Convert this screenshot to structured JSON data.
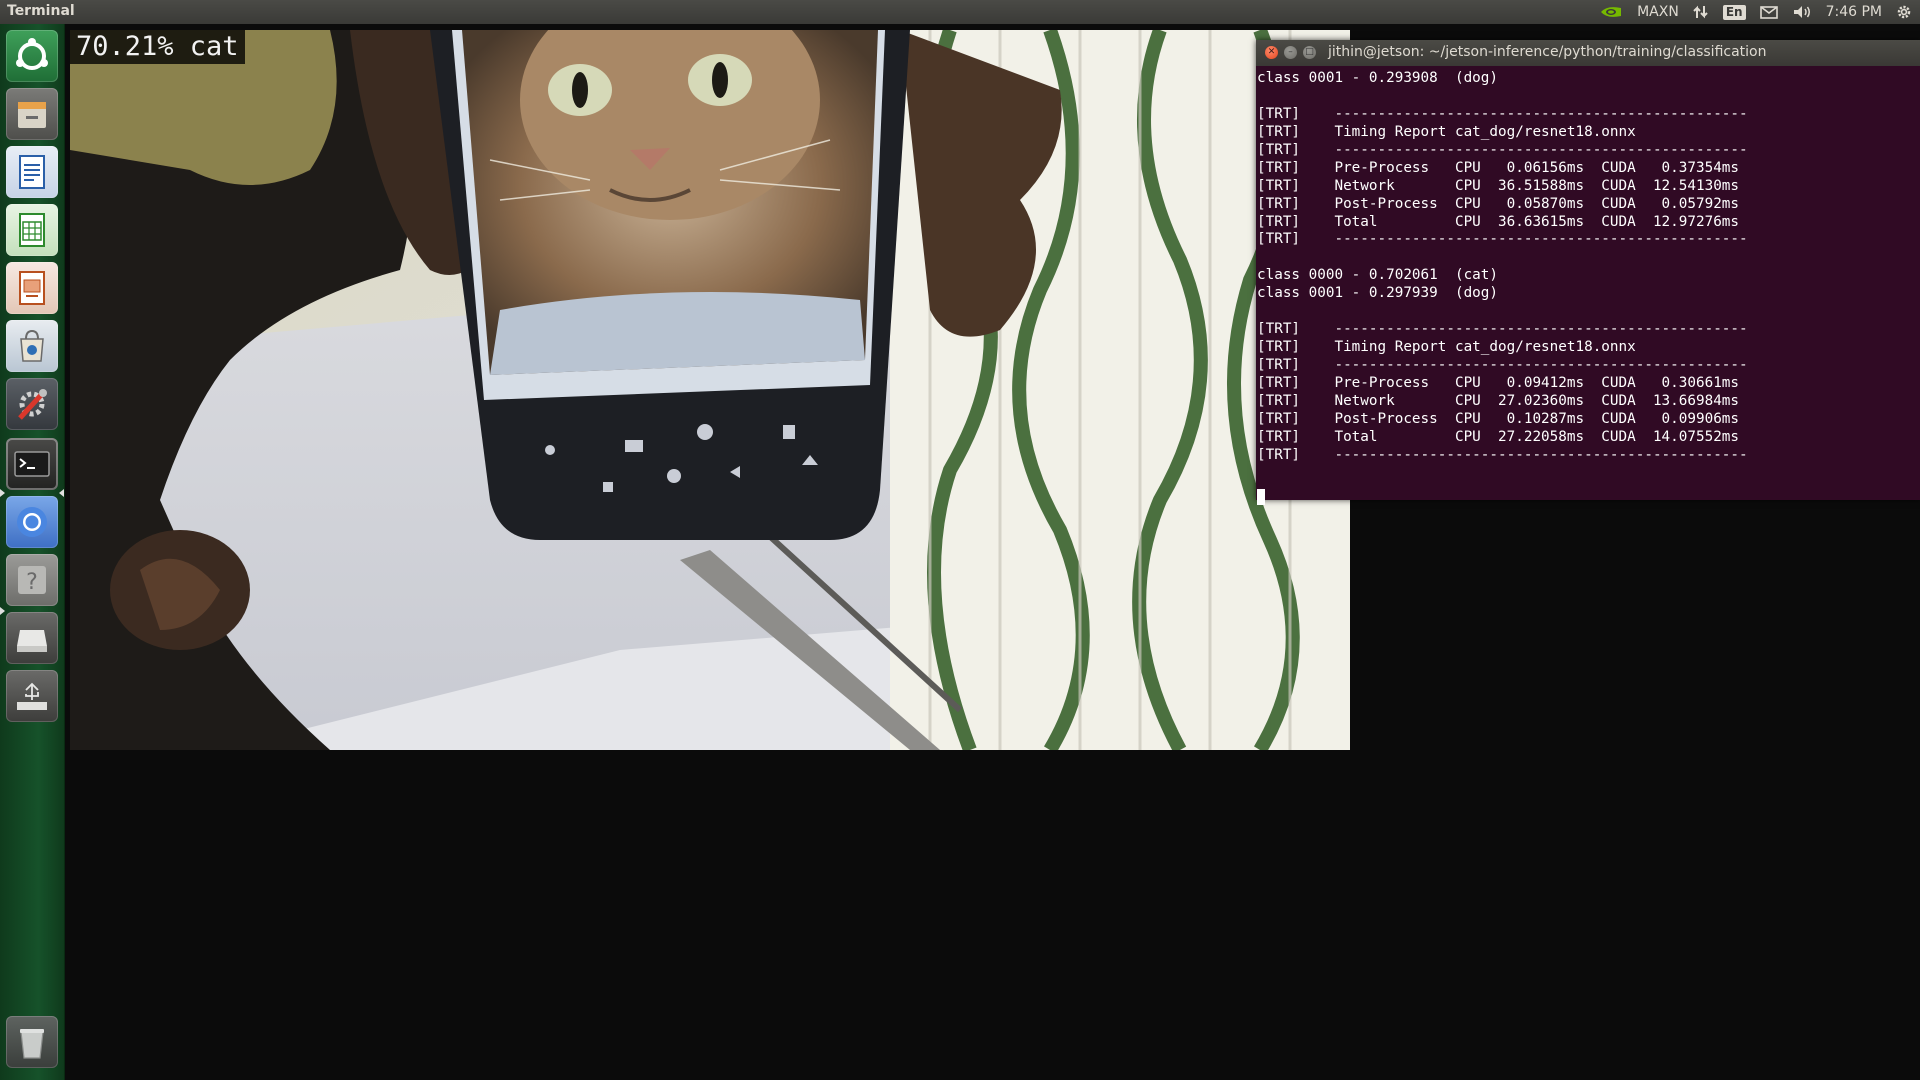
{
  "top_panel": {
    "app_title": "Terminal",
    "power_mode": "MAXN",
    "keyboard_layout": "En",
    "clock": "7:46 PM"
  },
  "launcher": {
    "items": [
      {
        "name": "ubuntu-software-updater-icon"
      },
      {
        "name": "files-icon"
      },
      {
        "name": "writer-icon"
      },
      {
        "name": "calc-icon"
      },
      {
        "name": "impress-icon"
      },
      {
        "name": "software-center-icon"
      },
      {
        "name": "system-settings-icon"
      },
      {
        "name": "terminal-icon"
      },
      {
        "name": "chromium-icon"
      },
      {
        "name": "help-icon"
      },
      {
        "name": "drive-icon"
      },
      {
        "name": "usb-drive-icon"
      },
      {
        "name": "trash-icon"
      }
    ]
  },
  "camera": {
    "overlay_text": "70.21% cat"
  },
  "terminal": {
    "title": "jithin@jetson: ~/jetson-inference/python/training/classification",
    "lines": [
      "class 0001 - 0.293908  (dog)",
      "",
      "[TRT]    ------------------------------------------------",
      "[TRT]    Timing Report cat_dog/resnet18.onnx",
      "[TRT]    ------------------------------------------------",
      "[TRT]    Pre-Process   CPU   0.06156ms  CUDA   0.37354ms",
      "[TRT]    Network       CPU  36.51588ms  CUDA  12.54130ms",
      "[TRT]    Post-Process  CPU   0.05870ms  CUDA   0.05792ms",
      "[TRT]    Total         CPU  36.63615ms  CUDA  12.97276ms",
      "[TRT]    ------------------------------------------------",
      "",
      "class 0000 - 0.702061  (cat)",
      "class 0001 - 0.297939  (dog)",
      "",
      "[TRT]    ------------------------------------------------",
      "[TRT]    Timing Report cat_dog/resnet18.onnx",
      "[TRT]    ------------------------------------------------",
      "[TRT]    Pre-Process   CPU   0.09412ms  CUDA   0.30661ms",
      "[TRT]    Network       CPU  27.02360ms  CUDA  13.66984ms",
      "[TRT]    Post-Process  CPU   0.10287ms  CUDA   0.09906ms",
      "[TRT]    Total         CPU  27.22058ms  CUDA  14.07552ms",
      "[TRT]    ------------------------------------------------",
      ""
    ]
  },
  "colors": {
    "terminal_bg": "#300a24",
    "launcher_bg": "#16522a",
    "panel_bg": "#3e3d39"
  }
}
